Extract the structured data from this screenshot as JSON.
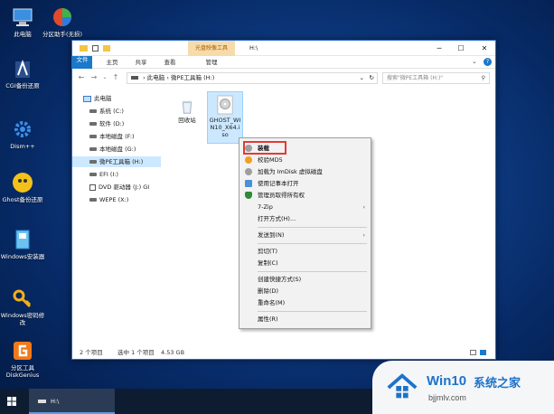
{
  "desktop": {
    "icons": [
      {
        "label": "此电脑",
        "icon": "computer-icon"
      },
      {
        "label": "分区助手(无损)",
        "icon": "partition-assistant-icon"
      },
      {
        "label": "CGI备份还原",
        "icon": "cgi-icon"
      },
      {
        "label": "Dism++",
        "icon": "dism-icon"
      },
      {
        "label": "Ghost备份还原",
        "icon": "ghost-icon"
      },
      {
        "label": "Windows安装器",
        "icon": "windows-installer-icon"
      },
      {
        "label": "Windows密码修改",
        "icon": "key-icon"
      },
      {
        "label": "分区工具DiskGenius",
        "icon": "diskgenius-icon"
      }
    ]
  },
  "window": {
    "context_tab_label": "光盘映像工具",
    "title": "H:\\",
    "ribbon_tabs": [
      "文件",
      "主页",
      "共享",
      "查看",
      "管理"
    ],
    "address_parts": [
      "此电脑",
      "微PE工具箱 (H:)"
    ],
    "search_placeholder": "搜索\"微PE工具箱 (H:)\"",
    "sidebar": [
      {
        "label": "此电脑",
        "type": "pc"
      },
      {
        "label": "系统 (C:)",
        "type": "drive"
      },
      {
        "label": "软件 (D:)",
        "type": "drive"
      },
      {
        "label": "本地磁盘 (F:)",
        "type": "drive"
      },
      {
        "label": "本地磁盘 (G:)",
        "type": "drive"
      },
      {
        "label": "微PE工具箱 (H:)",
        "type": "drive"
      },
      {
        "label": "EFI (I:)",
        "type": "drive"
      },
      {
        "label": "DVD 驱动器 (J:) GI",
        "type": "dvd"
      },
      {
        "label": "WEPE (X:)",
        "type": "drive"
      }
    ],
    "files": [
      {
        "label": "回收站",
        "icon": "recycle-bin-icon"
      },
      {
        "label": "GHOST_WIN10_X64.iso",
        "icon": "disc-image-icon"
      }
    ],
    "status": {
      "items": "2 个项目",
      "selected": "选中 1 个项目",
      "size": "4.53 GB"
    }
  },
  "context_menu": {
    "items": [
      {
        "label": "装载",
        "icon": "mount-disc-icon",
        "color": "#9e9e9e"
      },
      {
        "label": "校验MD5",
        "icon": "md5-icon",
        "color": "#f0a020"
      },
      {
        "label": "加载为 ImDisk 虚拟磁盘",
        "icon": "imdisk-icon",
        "color": "#9e9e9e"
      },
      {
        "label": "使用记事本打开",
        "icon": "notepad-icon",
        "color": "#4a90d9"
      },
      {
        "label": "管理员取得所有权",
        "icon": "shield-icon",
        "color": "#2e8b3a"
      },
      {
        "label": "7-Zip",
        "icon": "",
        "color": ""
      },
      {
        "label": "打开方式(H)...",
        "icon": "",
        "color": ""
      },
      {
        "label": "发送到(N)",
        "icon": "",
        "color": ""
      },
      {
        "label": "剪切(T)",
        "icon": "",
        "color": ""
      },
      {
        "label": "复制(C)",
        "icon": "",
        "color": ""
      },
      {
        "label": "创建快捷方式(S)",
        "icon": "",
        "color": ""
      },
      {
        "label": "删除(D)",
        "icon": "",
        "color": ""
      },
      {
        "label": "重命名(M)",
        "icon": "",
        "color": ""
      },
      {
        "label": "属性(R)",
        "icon": "",
        "color": ""
      }
    ]
  },
  "taskbar": {
    "app_label": "H:\\"
  },
  "watermark": {
    "brand": "Win10",
    "brand_cn": "系统之家",
    "url": "bjjmlv.com"
  },
  "colors": {
    "accent": "#1979ca",
    "highlight_border": "#e53935",
    "context_tab_bg": "#f6dcaa"
  }
}
